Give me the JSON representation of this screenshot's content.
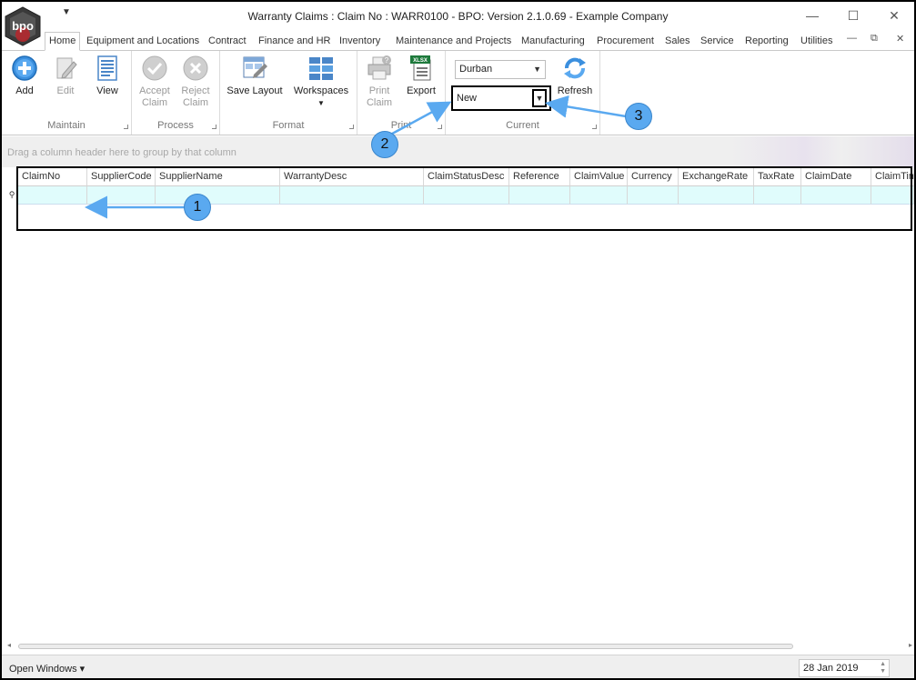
{
  "window": {
    "title": "Warranty Claims : Claim No : WARR0100 - BPO: Version 2.1.0.69 - Example Company",
    "logo_text": "bpo",
    "qat_glyph": "▼",
    "minimize": "—",
    "maximize": "☐",
    "close": "✕"
  },
  "tabs": [
    {
      "label": "Home"
    },
    {
      "label": "Equipment and Locations"
    },
    {
      "label": "Contract"
    },
    {
      "label": "Finance and HR"
    },
    {
      "label": "Inventory"
    },
    {
      "label": "Maintenance and Projects"
    },
    {
      "label": "Manufacturing"
    },
    {
      "label": "Procurement"
    },
    {
      "label": "Sales"
    },
    {
      "label": "Service"
    },
    {
      "label": "Reporting"
    },
    {
      "label": "Utilities"
    }
  ],
  "tab_controls": {
    "min": "—",
    "restore": "⧉",
    "close": "✕"
  },
  "ribbon": {
    "maintain": {
      "label": "Maintain",
      "add": "Add",
      "edit": "Edit",
      "view": "View"
    },
    "process": {
      "label": "Process",
      "accept_l1": "Accept",
      "accept_l2": "Claim",
      "reject_l1": "Reject",
      "reject_l2": "Claim"
    },
    "format": {
      "label": "Format",
      "save_layout": "Save Layout",
      "workspaces": "Workspaces"
    },
    "print": {
      "label": "Print",
      "print_l1": "Print",
      "print_l2": "Claim",
      "export": "Export",
      "export_badge": "XLSX"
    },
    "current": {
      "label": "Current",
      "site_value": "Durban",
      "status_value": "New",
      "refresh": "Refresh"
    }
  },
  "group_panel_hint": "Drag a column header here to group by that column",
  "grid": {
    "columns": [
      "ClaimNo",
      "SupplierCode",
      "SupplierName",
      "WarrantyDesc",
      "ClaimStatusDesc",
      "Reference",
      "ClaimValue",
      "Currency",
      "ExchangeRate",
      "TaxRate",
      "ClaimDate",
      "ClaimTime"
    ],
    "filter_row_icon": "⚲"
  },
  "callouts": [
    "1",
    "2",
    "3"
  ],
  "statusbar": {
    "open_windows": "Open Windows ▾",
    "date": "28 Jan 2019"
  }
}
